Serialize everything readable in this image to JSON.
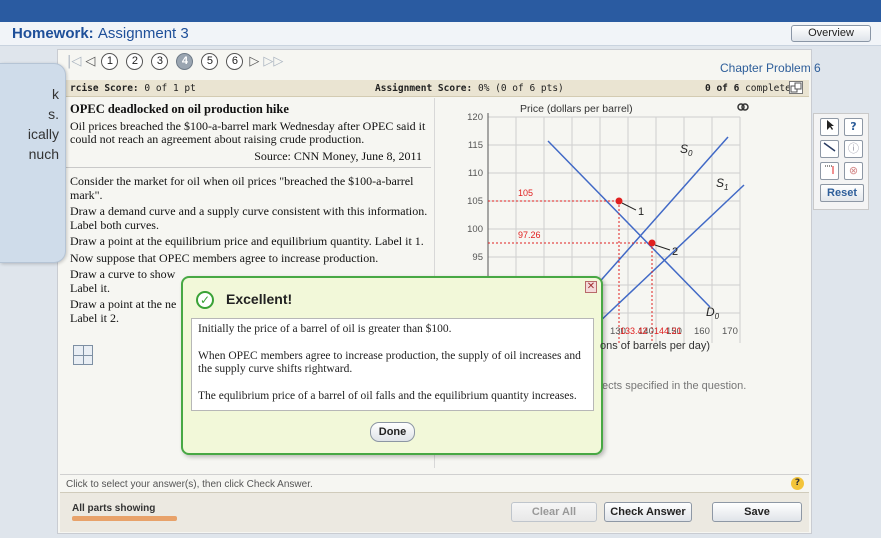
{
  "header": {
    "title_main": "Homework:",
    "title_sub": "Assignment 3",
    "overview_label": "Overview"
  },
  "nav": {
    "numbers": [
      "1",
      "2",
      "3",
      "4",
      "5",
      "6"
    ],
    "current": "4",
    "first_icon": "first-icon",
    "prev_icon": "prev-icon",
    "next_icon": "next-icon",
    "last_icon": "last-icon"
  },
  "chapter_label": "Chapter Problem 6",
  "scorebar": {
    "exercise_label": "rcise Score:",
    "exercise_value": "0 of 1 pt",
    "assignment_label": "Assignment Score:",
    "assignment_value": "0% (0 of 6 pts)",
    "complete_count": "0 of 6",
    "complete_label": "complete"
  },
  "question": {
    "headline": "OPEC deadlocked on oil production hike",
    "article": "Oil prices breached the $100-a-barrel mark Wednesday after OPEC said it could not reach an agreement about raising crude production.",
    "source": "Source: CNN Money, June 8, 2011",
    "p1": "Consider the market for oil when oil prices \"breached the $100-a-barrel mark\".",
    "p2": "Draw a demand curve and a supply curve consistent with this information. Label both curves.",
    "p3": "Draw a point at the equilibrium price and equilibrium quantity. Label it 1.",
    "p4": "Now suppose that OPEC members agree to increase production.",
    "p5": "Draw a curve to show",
    "p5b": "Label it.",
    "p6": "Draw a point at the ne",
    "p6b": "Label it 2."
  },
  "graph": {
    "ylabel": "Price (dollars per barrel)",
    "xlabel_partial": "ons of barrels per day)",
    "y_ticks": [
      "120",
      "115",
      "110",
      "105",
      "100",
      "95"
    ],
    "x_ticks": [
      "130",
      "140",
      "150",
      "160",
      "170"
    ],
    "curve_labels": {
      "s0": "S",
      "s0_sub": "0",
      "s1": "S",
      "s1_sub": "1",
      "d0": "D",
      "d0_sub": "0"
    },
    "point_labels": {
      "p1": "1",
      "p2": "2"
    },
    "red_values": {
      "price1": "105",
      "price2": "97.26",
      "qty1": "133.42",
      "qty2": "144.21"
    },
    "note_partial": "ects specified in the question."
  },
  "tools": {
    "pointer_icon": "pointer-icon",
    "help_icon": "help-icon",
    "line_icon": "line-icon",
    "info_icon": "info-icon",
    "bracket_icon": "bracket-icon",
    "delete_icon": "delete-icon",
    "reset_label": "Reset"
  },
  "help_text": "Click to select your answer(s), then click Check Answer.",
  "footer": {
    "parts_label": "All parts showing",
    "clear_all": "Clear All",
    "check_answer": "Check Answer",
    "save": "Save"
  },
  "side_panel": {
    "lines": [
      "k",
      "s.",
      "ically",
      "nuch"
    ]
  },
  "popup": {
    "title": "Excellent!",
    "line1": "Initially the price of a barrel of oil is greater than $100.",
    "line2": "When OPEC members agree to increase production, the supply of oil increases and the supply curve shifts rightward.",
    "line3": "The equlibrium price of a barrel of oil falls and the equilibrium quantity increases.",
    "done_label": "Done"
  },
  "colors": {
    "brand_blue": "#2a5ba1",
    "success_green": "#48a844",
    "curve_blue": "#4169c6",
    "marker_red": "#e02020"
  }
}
